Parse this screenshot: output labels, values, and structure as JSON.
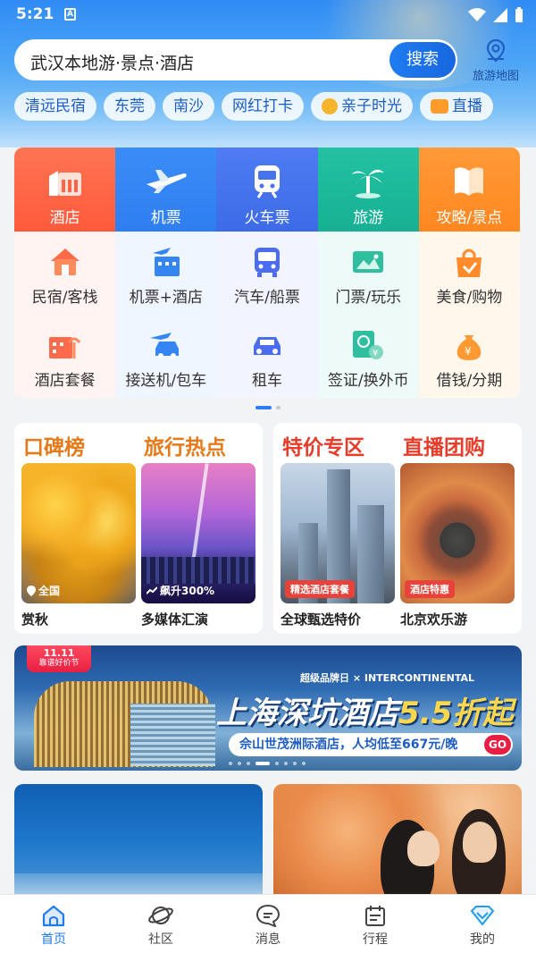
{
  "status": {
    "time": "5:21",
    "app_icon": "A"
  },
  "search": {
    "query": "武汉本地游·景点·酒店",
    "button": "搜索"
  },
  "map_button": {
    "label": "旅游地图"
  },
  "chips": [
    {
      "label": "清远民宿",
      "icon": null
    },
    {
      "label": "东莞",
      "icon": null
    },
    {
      "label": "南沙",
      "icon": null
    },
    {
      "label": "网红打卡",
      "icon": null
    },
    {
      "label": "亲子时光",
      "icon": "bee-icon"
    },
    {
      "label": "直播",
      "icon": "live-icon"
    }
  ],
  "main_services": [
    {
      "label": "酒店",
      "icon": "hotel-icon",
      "color": "#ff6446"
    },
    {
      "label": "机票",
      "icon": "plane-icon",
      "color": "#3586f4"
    },
    {
      "label": "火车票",
      "icon": "train-icon",
      "color": "#4574ed"
    },
    {
      "label": "旅游",
      "icon": "palm-icon",
      "color": "#1db89b"
    },
    {
      "label": "攻略/景点",
      "icon": "book-icon",
      "color": "#ff922c"
    }
  ],
  "sub_services_row1": [
    {
      "label": "民宿/客栈",
      "icon": "house-icon"
    },
    {
      "label": "机票+酒店",
      "icon": "plane-hotel-icon"
    },
    {
      "label": "汽车/船票",
      "icon": "bus-icon"
    },
    {
      "label": "门票/玩乐",
      "icon": "ticket-icon"
    },
    {
      "label": "美食/购物",
      "icon": "bag-icon"
    }
  ],
  "sub_services_row2": [
    {
      "label": "酒店套餐",
      "icon": "hotel-package-icon"
    },
    {
      "label": "接送机/包车",
      "icon": "plane-car-icon"
    },
    {
      "label": "租车",
      "icon": "car-icon"
    },
    {
      "label": "签证/换外币",
      "icon": "visa-icon"
    },
    {
      "label": "借钱/分期",
      "icon": "money-bag-icon"
    }
  ],
  "cards": {
    "left": {
      "title1": "口碑榜",
      "title2": "旅行热点",
      "item1": {
        "caption": "赏秋",
        "tag": "全国"
      },
      "item2": {
        "caption": "多媒体汇演",
        "tag": "飙升300%"
      }
    },
    "right": {
      "title1": "特价专区",
      "title2": "直播团购",
      "item1": {
        "caption": "全球甄选特价",
        "tag": "精选酒店套餐"
      },
      "item2": {
        "caption": "北京欢乐游",
        "tag": "酒店特惠"
      }
    }
  },
  "banner": {
    "badge_top": "11.11",
    "badge_bottom": "靠谱好价节",
    "brand": "超级品牌日 × INTERCONTINENTAL",
    "headline_main": "上海深坑酒店",
    "headline_price": "5.5折起",
    "subline": "佘山世茂洲际酒店，人均低至667元/晚",
    "go": "GO"
  },
  "tabs": [
    {
      "label": "首页",
      "icon": "home-icon",
      "active": true
    },
    {
      "label": "社区",
      "icon": "planet-icon",
      "active": false
    },
    {
      "label": "消息",
      "icon": "message-icon",
      "active": false
    },
    {
      "label": "行程",
      "icon": "calendar-icon",
      "active": false
    },
    {
      "label": "我的",
      "icon": "diamond-icon",
      "active": false
    }
  ],
  "colors": {
    "accent": "#1f7cf0",
    "headline_orange": "#e6791a",
    "headline_red": "#e83c2a"
  }
}
